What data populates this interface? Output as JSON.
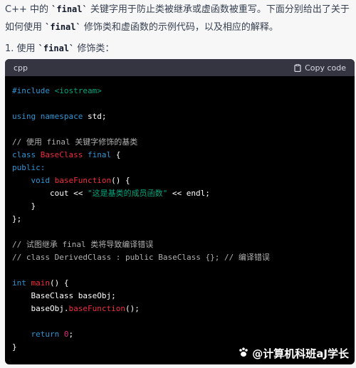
{
  "intro": {
    "part1": "C++ 中的 ",
    "code1": "`final`",
    "part2": " 关键字用于防止类被继承或虚函数被重写。下面分别给出了关于如何使用 ",
    "code2": "`final`",
    "part3": " 修饰类和虚函数的示例代码，以及相应的解释。"
  },
  "step": {
    "prefix": "1. 使用 ",
    "code": "`final`",
    "suffix": " 修饰类："
  },
  "code_block": {
    "language": "cpp",
    "copy_label": "Copy code",
    "lines": {
      "l1a": "#include ",
      "l1b": "<iostream>",
      "l3a": "using namespace",
      "l3b": " std;",
      "l5": "// 使用 final 关键字修饰的基类",
      "l6a": "class ",
      "l6b": "BaseClass ",
      "l6c": "final",
      "l6d": " {",
      "l7": "public:",
      "l8a": "    ",
      "l8b": "void ",
      "l8c": "baseFunction",
      "l8d": "() {",
      "l9a": "        cout << ",
      "l9b": "\"这是基类的成员函数\"",
      "l9c": " << endl;",
      "l10": "    }",
      "l11": "};",
      "l13": "// 试图继承 final 类将导致编译错误",
      "l14": "// class DerivedClass : public BaseClass {}; // 编译错误",
      "l16a": "int ",
      "l16b": "main",
      "l16c": "() {",
      "l17": "    BaseClass baseObj;",
      "l18a": "    baseObj.",
      "l18b": "baseFunction",
      "l18c": "();",
      "l20a": "    ",
      "l20b": "return ",
      "l20c": "0",
      "l20d": ";",
      "l21": "}"
    }
  },
  "watermark": {
    "text": "@计算机科班aJ学长",
    "icon": "paw-icon"
  }
}
